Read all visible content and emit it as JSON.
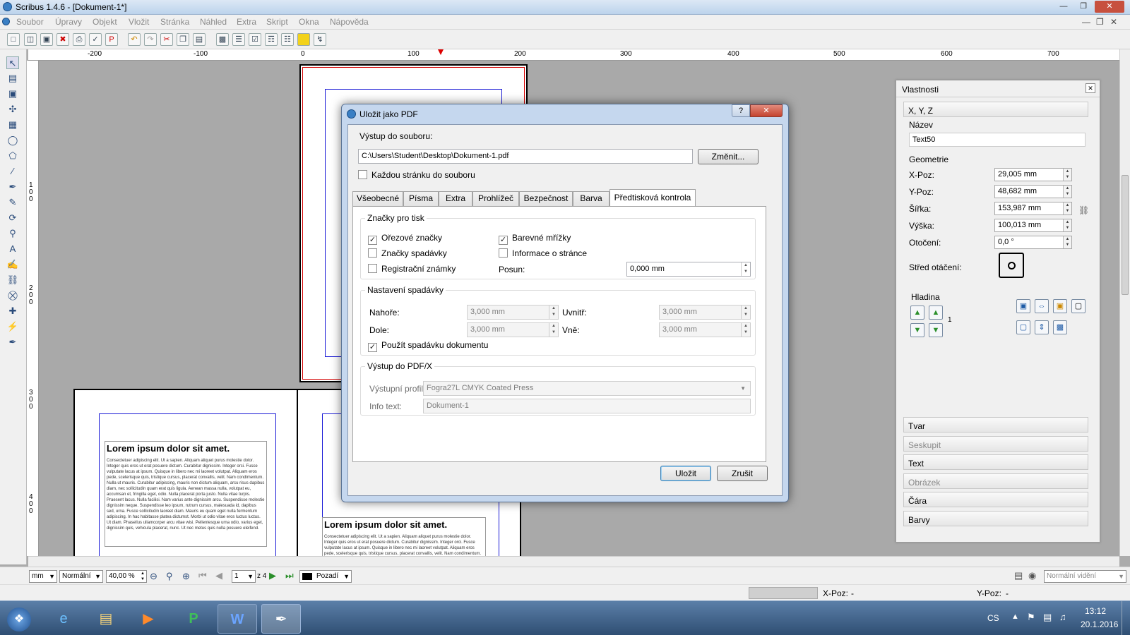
{
  "window": {
    "title": "Scribus 1.4.6 - [Dokument-1*]"
  },
  "menu": [
    "Soubor",
    "Úpravy",
    "Objekt",
    "Vložit",
    "Stránka",
    "Náhled",
    "Extra",
    "Skript",
    "Okna",
    "Nápověda"
  ],
  "ruler": {
    "h_ticks": [
      "-200",
      "-100",
      "0",
      "100",
      "200",
      "300",
      "400",
      "500",
      "600",
      "700"
    ]
  },
  "canvas_text": {
    "heading": "Lorem ipsum dolor sit amet.",
    "body": "Consectetuer adipiscing elit. Ut a sapien. Aliquam aliquet purus molestie dolor. Integer quis eros ut erat posuere dictum. Curabitur dignissim. Integer orci. Fusce vulputate lacus at ipsum. Quisque in libero nec mi laoreet volutpat. Aliquam eros pede, scelerisque quis, tristique cursus, placerat convallis, velit. Nam condimentum. Nulla ut mauris. Curabitur adipiscing, mauris non dictum aliquam, arcu risus dapibus diam, nec sollicitudin quam erat quis ligula. Aenean massa nulla, volutpat eu, accumsan et, fringilla eget, odio. Nulla placerat porta justo. Nulla vitae turpis. Praesent lacus. Nulla facilisi. Nam varius ante dignissim arcu. Suspendisse molestie dignissim neque. Suspendisse leo ipsum, rutrum cursus, malesuada id, dapibus sed, urna. Fusce sollicitudin laoreet diam. Mauris eu quam eget nulla fermentum adipiscing. In hac habitasse platea dictumst. Morbi ut odio vitae eros luctus luctus. Ut diam. Phasellus ullamcorper arcu vitae wisi. Pellentesque urna odio, varius eget, dignissim quis, vehicula placerat, nunc. Ut nec metus quis nulla posuere eleifend."
  },
  "dialog": {
    "title": "Uložit jako PDF",
    "help": "?",
    "close": "✕",
    "output_label": "Výstup do souboru:",
    "output_path": "C:\\Users\\Student\\Desktop\\Dokument-1.pdf",
    "change_btn": "Změnit...",
    "each_page": "Každou stránku do souboru",
    "tabs": [
      "Všeobecné",
      "Písma",
      "Extra",
      "Prohlížeč",
      "Bezpečnost",
      "Barva",
      "Předtisková kontrola"
    ],
    "marks": {
      "title": "Značky pro tisk",
      "crop": "Ořezové značky",
      "bleed": "Značky spadávky",
      "registration": "Registrační známky",
      "color_bars": "Barevné mřížky",
      "page_info": "Informace o stránce",
      "offset_label": "Posun:",
      "offset_value": "0,000 mm"
    },
    "bleed": {
      "title": "Nastavení spadávky",
      "top_label": "Nahoře:",
      "top": "3,000 mm",
      "bottom_label": "Dole:",
      "bottom": "3,000 mm",
      "inside_label": "Uvnitř:",
      "inside": "3,000 mm",
      "outside_label": "Vně:",
      "outside": "3,000 mm",
      "use_doc": "Použít spadávku dokumentu"
    },
    "pdfx": {
      "title": "Výstup do PDF/X",
      "profile_label": "Výstupní profil:",
      "profile": "Fogra27L CMYK Coated Press",
      "info_label": "Info text:",
      "info": "Dokument-1"
    },
    "save_btn": "Uložit",
    "cancel_btn": "Zrušit"
  },
  "properties": {
    "title": "Vlastnosti",
    "xyz": "X, Y, Z",
    "name_label": "Název",
    "name": "Text50",
    "geometry_label": "Geometrie",
    "x_label": "X-Poz:",
    "x": "29,005 mm",
    "y_label": "Y-Poz:",
    "y": "48,682 mm",
    "w_label": "Šířka:",
    "w": "153,987 mm",
    "h_label": "Výška:",
    "h": "100,013 mm",
    "rot_label": "Otočení:",
    "rot": "0,0 °",
    "pivot_label": "Střed otáčení:",
    "layer_label": "Hladina",
    "layer_num": "1",
    "sections": [
      "Tvar",
      "Seskupit",
      "Text",
      "Obrázek",
      "Čára",
      "Barvy"
    ]
  },
  "bottombar": {
    "unit": "mm",
    "mode": "Normální",
    "zoom": "40,00 %",
    "page": "1",
    "of_pages": "z 4",
    "layer": "Pozadí",
    "view": "Normální vidění"
  },
  "status": {
    "x_label": "X-Poz:",
    "x": "-",
    "y_label": "Y-Poz:",
    "y": "-"
  },
  "tray": {
    "lang": "CS",
    "time": "13:12",
    "date": "20.1.2016"
  },
  "colors": {
    "accent": "#1a1ad6",
    "dialog_frame": "#c5d7ee",
    "bleed_line": "#d40000"
  }
}
